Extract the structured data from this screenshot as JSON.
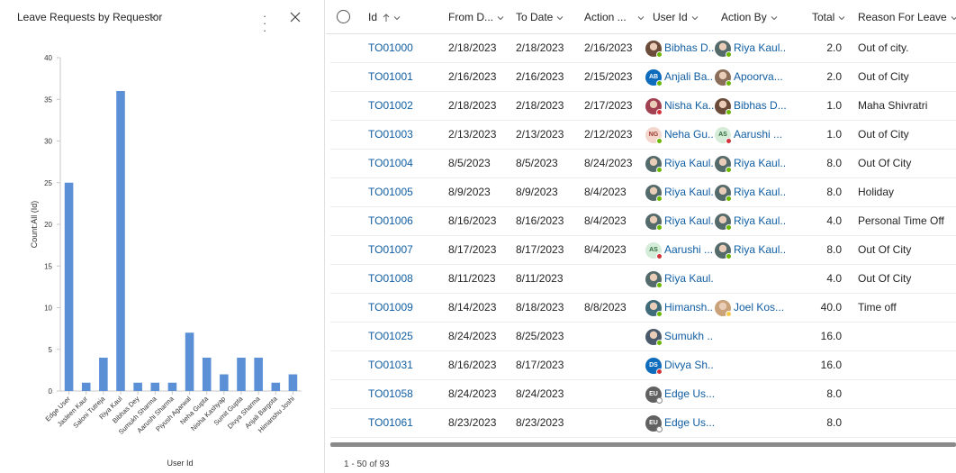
{
  "chart_panel": {
    "title": "Leave Requests by Requestor",
    "icons": {
      "title_dropdown": "chevron-down-icon",
      "more": "more-options-icon",
      "close": "close-icon"
    }
  },
  "chart_data": {
    "type": "bar",
    "title": "Leave Requests by Requestor",
    "xlabel": "User Id",
    "ylabel": "Count:All (Id)",
    "ylim": [
      0,
      40
    ],
    "yticks": [
      "0",
      "5",
      "10",
      "15",
      "20",
      "25",
      "30",
      "35",
      "40"
    ],
    "categories": [
      "Edge User",
      "Jasleen Kaur",
      "Saloni Tutreja",
      "Riya Kaul",
      "Bibhas Dey",
      "Sumukh Sharma",
      "Aarushi Sharma",
      "Piyush Agarwal",
      "Neha Gupta",
      "Nisha Kashyap",
      "Sumit Gupta",
      "Divya Sharma",
      "Anjali Bargota",
      "Himanshu Joshi"
    ],
    "values": [
      25,
      1,
      4,
      36,
      1,
      1,
      1,
      7,
      4,
      2,
      4,
      4,
      1,
      2
    ],
    "bar_color": "#5b8fd6",
    "grid": false
  },
  "grid": {
    "columns": {
      "id": "Id",
      "from_date": "From D...",
      "to_date": "To Date",
      "action": "Action ...",
      "user_id": "User Id",
      "action_by": "Action By",
      "total": "Total",
      "reason": "Reason For Leave"
    },
    "sort_icon": "arrow-up-icon",
    "rows": [
      {
        "id": "TO01000",
        "from": "2/18/2023",
        "to": "2/18/2023",
        "action": "2/16/2023",
        "user": {
          "name": "Bibhas D...",
          "initials": "",
          "color": "#6b4c3b",
          "presence": "#6bb700",
          "photo": true
        },
        "by": {
          "name": "Riya Kaul...",
          "initials": "",
          "color": "#556b6b",
          "presence": "#6bb700",
          "photo": true
        },
        "total": "2.0",
        "reason": "Out of city."
      },
      {
        "id": "TO01001",
        "from": "2/16/2023",
        "to": "2/16/2023",
        "action": "2/15/2023",
        "user": {
          "name": "Anjali Ba...",
          "initials": "AB",
          "color": "#0f6cbd",
          "presence": "#6bb700",
          "photo": false
        },
        "by": {
          "name": "Apoorva...",
          "initials": "",
          "color": "#8a6e5a",
          "presence": "#6bb700",
          "photo": true
        },
        "total": "2.0",
        "reason": "Out of City"
      },
      {
        "id": "TO01002",
        "from": "2/18/2023",
        "to": "2/18/2023",
        "action": "2/17/2023",
        "user": {
          "name": "Nisha Ka...",
          "initials": "",
          "color": "#a04050",
          "presence": "#d13438",
          "photo": true
        },
        "by": {
          "name": "Bibhas D...",
          "initials": "",
          "color": "#6b4c3b",
          "presence": "#6bb700",
          "photo": true
        },
        "total": "1.0",
        "reason": "Maha Shivratri"
      },
      {
        "id": "TO01003",
        "from": "2/13/2023",
        "to": "2/13/2023",
        "action": "2/12/2023",
        "user": {
          "name": "Neha Gu...",
          "initials": "NG",
          "color": "#f4d6cf",
          "presence": "#6bb700",
          "photo": false,
          "textcolor": "#9b3a2a"
        },
        "by": {
          "name": "Aarushi ...",
          "initials": "AS",
          "color": "#d5ecd9",
          "presence": "#d13438",
          "photo": false,
          "textcolor": "#2b6b3a"
        },
        "total": "1.0",
        "reason": "Out of City"
      },
      {
        "id": "TO01004",
        "from": "8/5/2023",
        "to": "8/5/2023",
        "action": "8/24/2023",
        "user": {
          "name": "Riya Kaul...",
          "initials": "",
          "color": "#556b6b",
          "presence": "#6bb700",
          "photo": true
        },
        "by": {
          "name": "Riya Kaul...",
          "initials": "",
          "color": "#556b6b",
          "presence": "#6bb700",
          "photo": true
        },
        "total": "8.0",
        "reason": "Out Of City"
      },
      {
        "id": "TO01005",
        "from": "8/9/2023",
        "to": "8/9/2023",
        "action": "8/4/2023",
        "user": {
          "name": "Riya Kaul...",
          "initials": "",
          "color": "#556b6b",
          "presence": "#6bb700",
          "photo": true
        },
        "by": {
          "name": "Riya Kaul...",
          "initials": "",
          "color": "#556b6b",
          "presence": "#6bb700",
          "photo": true
        },
        "total": "8.0",
        "reason": "Holiday"
      },
      {
        "id": "TO01006",
        "from": "8/16/2023",
        "to": "8/16/2023",
        "action": "8/4/2023",
        "user": {
          "name": "Riya Kaul...",
          "initials": "",
          "color": "#556b6b",
          "presence": "#6bb700",
          "photo": true
        },
        "by": {
          "name": "Riya Kaul...",
          "initials": "",
          "color": "#556b6b",
          "presence": "#6bb700",
          "photo": true
        },
        "total": "4.0",
        "reason": "Personal Time Off"
      },
      {
        "id": "TO01007",
        "from": "8/17/2023",
        "to": "8/17/2023",
        "action": "8/4/2023",
        "user": {
          "name": "Aarushi ...",
          "initials": "AS",
          "color": "#d5ecd9",
          "presence": "#d13438",
          "photo": false,
          "textcolor": "#2b6b3a"
        },
        "by": {
          "name": "Riya Kaul...",
          "initials": "",
          "color": "#556b6b",
          "presence": "#6bb700",
          "photo": true
        },
        "total": "8.0",
        "reason": "Out Of City"
      },
      {
        "id": "TO01008",
        "from": "8/11/2023",
        "to": "8/11/2023",
        "action": "",
        "user": {
          "name": "Riya Kaul...",
          "initials": "",
          "color": "#556b6b",
          "presence": "#6bb700",
          "photo": true
        },
        "by": null,
        "total": "4.0",
        "reason": "Out Of City"
      },
      {
        "id": "TO01009",
        "from": "8/14/2023",
        "to": "8/18/2023",
        "action": "8/8/2023",
        "user": {
          "name": "Himansh...",
          "initials": "",
          "color": "#3f6b7a",
          "presence": "#6bb700",
          "photo": true
        },
        "by": {
          "name": "Joel Kos...",
          "initials": "",
          "color": "#c9a27a",
          "presence": "#f7c948",
          "photo": true
        },
        "total": "40.0",
        "reason": "Time off"
      },
      {
        "id": "TO01025",
        "from": "8/24/2023",
        "to": "8/25/2023",
        "action": "",
        "user": {
          "name": "Sumukh ...",
          "initials": "",
          "color": "#4a5a6a",
          "presence": "#6bb700",
          "photo": true
        },
        "by": null,
        "total": "16.0",
        "reason": ""
      },
      {
        "id": "TO01031",
        "from": "8/16/2023",
        "to": "8/17/2023",
        "action": "",
        "user": {
          "name": "Divya Sh...",
          "initials": "DS",
          "color": "#0f6cbd",
          "presence": "#d13438",
          "photo": false
        },
        "by": null,
        "total": "16.0",
        "reason": ""
      },
      {
        "id": "TO01058",
        "from": "8/24/2023",
        "to": "8/24/2023",
        "action": "",
        "user": {
          "name": "Edge Us...",
          "initials": "EU",
          "color": "#616161",
          "presence": "#ffffff",
          "photo": false
        },
        "by": null,
        "total": "8.0",
        "reason": ""
      },
      {
        "id": "TO01061",
        "from": "8/23/2023",
        "to": "8/23/2023",
        "action": "",
        "user": {
          "name": "Edge Us...",
          "initials": "EU",
          "color": "#616161",
          "presence": "#ffffff",
          "photo": false
        },
        "by": null,
        "total": "8.0",
        "reason": ""
      }
    ],
    "footer": "1 - 50 of 93"
  }
}
